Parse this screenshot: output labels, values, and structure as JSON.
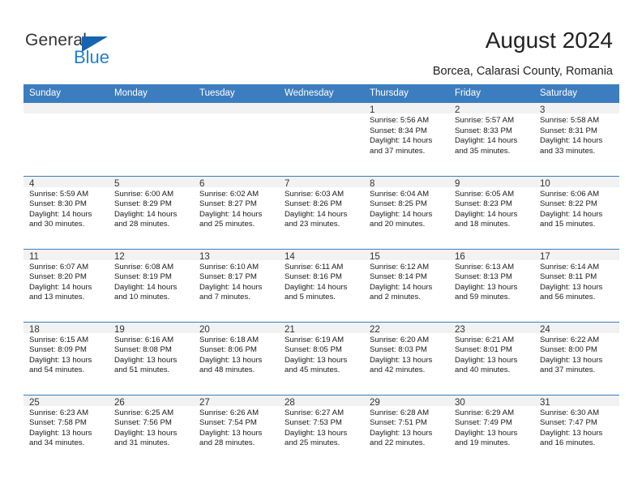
{
  "brand": {
    "name_top": "General",
    "name_bottom": "Blue",
    "accent_color": "#1f7fd0",
    "triangle_color": "#1565b0"
  },
  "header": {
    "title": "August 2024",
    "subtitle": "Borcea, Calarasi County, Romania"
  },
  "calendar": {
    "header_bg": "#3C7DBF",
    "daynum_bg": "#F2F2F2",
    "weekdays": [
      "Sunday",
      "Monday",
      "Tuesday",
      "Wednesday",
      "Thursday",
      "Friday",
      "Saturday"
    ],
    "weeks": [
      [
        {
          "day": "",
          "sunrise": "",
          "sunset": "",
          "daylight_line1": "",
          "daylight_line2": "",
          "empty": true
        },
        {
          "day": "",
          "sunrise": "",
          "sunset": "",
          "daylight_line1": "",
          "daylight_line2": "",
          "empty": true
        },
        {
          "day": "",
          "sunrise": "",
          "sunset": "",
          "daylight_line1": "",
          "daylight_line2": "",
          "empty": true
        },
        {
          "day": "",
          "sunrise": "",
          "sunset": "",
          "daylight_line1": "",
          "daylight_line2": "",
          "empty": true
        },
        {
          "day": "1",
          "sunrise": "Sunrise: 5:56 AM",
          "sunset": "Sunset: 8:34 PM",
          "daylight_line1": "Daylight: 14 hours",
          "daylight_line2": "and 37 minutes.",
          "empty": false
        },
        {
          "day": "2",
          "sunrise": "Sunrise: 5:57 AM",
          "sunset": "Sunset: 8:33 PM",
          "daylight_line1": "Daylight: 14 hours",
          "daylight_line2": "and 35 minutes.",
          "empty": false
        },
        {
          "day": "3",
          "sunrise": "Sunrise: 5:58 AM",
          "sunset": "Sunset: 8:31 PM",
          "daylight_line1": "Daylight: 14 hours",
          "daylight_line2": "and 33 minutes.",
          "empty": false
        }
      ],
      [
        {
          "day": "4",
          "sunrise": "Sunrise: 5:59 AM",
          "sunset": "Sunset: 8:30 PM",
          "daylight_line1": "Daylight: 14 hours",
          "daylight_line2": "and 30 minutes.",
          "empty": false
        },
        {
          "day": "5",
          "sunrise": "Sunrise: 6:00 AM",
          "sunset": "Sunset: 8:29 PM",
          "daylight_line1": "Daylight: 14 hours",
          "daylight_line2": "and 28 minutes.",
          "empty": false
        },
        {
          "day": "6",
          "sunrise": "Sunrise: 6:02 AM",
          "sunset": "Sunset: 8:27 PM",
          "daylight_line1": "Daylight: 14 hours",
          "daylight_line2": "and 25 minutes.",
          "empty": false
        },
        {
          "day": "7",
          "sunrise": "Sunrise: 6:03 AM",
          "sunset": "Sunset: 8:26 PM",
          "daylight_line1": "Daylight: 14 hours",
          "daylight_line2": "and 23 minutes.",
          "empty": false
        },
        {
          "day": "8",
          "sunrise": "Sunrise: 6:04 AM",
          "sunset": "Sunset: 8:25 PM",
          "daylight_line1": "Daylight: 14 hours",
          "daylight_line2": "and 20 minutes.",
          "empty": false
        },
        {
          "day": "9",
          "sunrise": "Sunrise: 6:05 AM",
          "sunset": "Sunset: 8:23 PM",
          "daylight_line1": "Daylight: 14 hours",
          "daylight_line2": "and 18 minutes.",
          "empty": false
        },
        {
          "day": "10",
          "sunrise": "Sunrise: 6:06 AM",
          "sunset": "Sunset: 8:22 PM",
          "daylight_line1": "Daylight: 14 hours",
          "daylight_line2": "and 15 minutes.",
          "empty": false
        }
      ],
      [
        {
          "day": "11",
          "sunrise": "Sunrise: 6:07 AM",
          "sunset": "Sunset: 8:20 PM",
          "daylight_line1": "Daylight: 14 hours",
          "daylight_line2": "and 13 minutes.",
          "empty": false
        },
        {
          "day": "12",
          "sunrise": "Sunrise: 6:08 AM",
          "sunset": "Sunset: 8:19 PM",
          "daylight_line1": "Daylight: 14 hours",
          "daylight_line2": "and 10 minutes.",
          "empty": false
        },
        {
          "day": "13",
          "sunrise": "Sunrise: 6:10 AM",
          "sunset": "Sunset: 8:17 PM",
          "daylight_line1": "Daylight: 14 hours",
          "daylight_line2": "and 7 minutes.",
          "empty": false
        },
        {
          "day": "14",
          "sunrise": "Sunrise: 6:11 AM",
          "sunset": "Sunset: 8:16 PM",
          "daylight_line1": "Daylight: 14 hours",
          "daylight_line2": "and 5 minutes.",
          "empty": false
        },
        {
          "day": "15",
          "sunrise": "Sunrise: 6:12 AM",
          "sunset": "Sunset: 8:14 PM",
          "daylight_line1": "Daylight: 14 hours",
          "daylight_line2": "and 2 minutes.",
          "empty": false
        },
        {
          "day": "16",
          "sunrise": "Sunrise: 6:13 AM",
          "sunset": "Sunset: 8:13 PM",
          "daylight_line1": "Daylight: 13 hours",
          "daylight_line2": "and 59 minutes.",
          "empty": false
        },
        {
          "day": "17",
          "sunrise": "Sunrise: 6:14 AM",
          "sunset": "Sunset: 8:11 PM",
          "daylight_line1": "Daylight: 13 hours",
          "daylight_line2": "and 56 minutes.",
          "empty": false
        }
      ],
      [
        {
          "day": "18",
          "sunrise": "Sunrise: 6:15 AM",
          "sunset": "Sunset: 8:09 PM",
          "daylight_line1": "Daylight: 13 hours",
          "daylight_line2": "and 54 minutes.",
          "empty": false
        },
        {
          "day": "19",
          "sunrise": "Sunrise: 6:16 AM",
          "sunset": "Sunset: 8:08 PM",
          "daylight_line1": "Daylight: 13 hours",
          "daylight_line2": "and 51 minutes.",
          "empty": false
        },
        {
          "day": "20",
          "sunrise": "Sunrise: 6:18 AM",
          "sunset": "Sunset: 8:06 PM",
          "daylight_line1": "Daylight: 13 hours",
          "daylight_line2": "and 48 minutes.",
          "empty": false
        },
        {
          "day": "21",
          "sunrise": "Sunrise: 6:19 AM",
          "sunset": "Sunset: 8:05 PM",
          "daylight_line1": "Daylight: 13 hours",
          "daylight_line2": "and 45 minutes.",
          "empty": false
        },
        {
          "day": "22",
          "sunrise": "Sunrise: 6:20 AM",
          "sunset": "Sunset: 8:03 PM",
          "daylight_line1": "Daylight: 13 hours",
          "daylight_line2": "and 42 minutes.",
          "empty": false
        },
        {
          "day": "23",
          "sunrise": "Sunrise: 6:21 AM",
          "sunset": "Sunset: 8:01 PM",
          "daylight_line1": "Daylight: 13 hours",
          "daylight_line2": "and 40 minutes.",
          "empty": false
        },
        {
          "day": "24",
          "sunrise": "Sunrise: 6:22 AM",
          "sunset": "Sunset: 8:00 PM",
          "daylight_line1": "Daylight: 13 hours",
          "daylight_line2": "and 37 minutes.",
          "empty": false
        }
      ],
      [
        {
          "day": "25",
          "sunrise": "Sunrise: 6:23 AM",
          "sunset": "Sunset: 7:58 PM",
          "daylight_line1": "Daylight: 13 hours",
          "daylight_line2": "and 34 minutes.",
          "empty": false
        },
        {
          "day": "26",
          "sunrise": "Sunrise: 6:25 AM",
          "sunset": "Sunset: 7:56 PM",
          "daylight_line1": "Daylight: 13 hours",
          "daylight_line2": "and 31 minutes.",
          "empty": false
        },
        {
          "day": "27",
          "sunrise": "Sunrise: 6:26 AM",
          "sunset": "Sunset: 7:54 PM",
          "daylight_line1": "Daylight: 13 hours",
          "daylight_line2": "and 28 minutes.",
          "empty": false
        },
        {
          "day": "28",
          "sunrise": "Sunrise: 6:27 AM",
          "sunset": "Sunset: 7:53 PM",
          "daylight_line1": "Daylight: 13 hours",
          "daylight_line2": "and 25 minutes.",
          "empty": false
        },
        {
          "day": "29",
          "sunrise": "Sunrise: 6:28 AM",
          "sunset": "Sunset: 7:51 PM",
          "daylight_line1": "Daylight: 13 hours",
          "daylight_line2": "and 22 minutes.",
          "empty": false
        },
        {
          "day": "30",
          "sunrise": "Sunrise: 6:29 AM",
          "sunset": "Sunset: 7:49 PM",
          "daylight_line1": "Daylight: 13 hours",
          "daylight_line2": "and 19 minutes.",
          "empty": false
        },
        {
          "day": "31",
          "sunrise": "Sunrise: 6:30 AM",
          "sunset": "Sunset: 7:47 PM",
          "daylight_line1": "Daylight: 13 hours",
          "daylight_line2": "and 16 minutes.",
          "empty": false
        }
      ]
    ]
  }
}
